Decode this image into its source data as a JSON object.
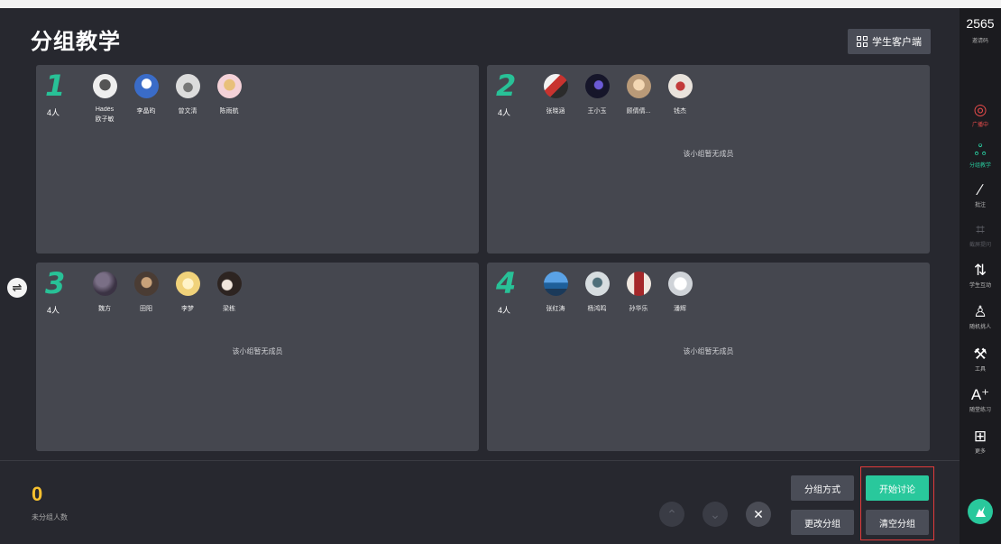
{
  "header": {
    "title": "分组教学",
    "client_button": "学生客户端"
  },
  "groups": [
    {
      "number": "1",
      "count": "4人",
      "members": [
        "Hadès",
        "李晶昀",
        "曾文清",
        "陈雨航"
      ],
      "extra_name": "欧子敏",
      "empty_text": ""
    },
    {
      "number": "2",
      "count": "4人",
      "members": [
        "张晓涵",
        "王小玉",
        "顾倩倩...",
        "钱杰"
      ],
      "empty_text": "该小组暂无成员"
    },
    {
      "number": "3",
      "count": "4人",
      "members": [
        "魏方",
        "田阳",
        "李梦",
        "梁栋"
      ],
      "empty_text": "该小组暂无成员"
    },
    {
      "number": "4",
      "count": "4人",
      "members": [
        "张红涛",
        "杨鸿鸣",
        "孙华乐",
        "潘辉"
      ],
      "empty_text": "该小组暂无成员"
    }
  ],
  "bottom": {
    "ungrouped_count": "0",
    "ungrouped_label": "未分组人数",
    "btn_group_method": "分组方式",
    "btn_change_group": "更改分组",
    "btn_start_discussion": "开始讨论",
    "btn_clear_group": "清空分组"
  },
  "sidebar": {
    "code": "2565",
    "code_label": "邀请码",
    "items": [
      {
        "label": "广播中",
        "icon": "broadcast-icon",
        "state": "red"
      },
      {
        "label": "分组教学",
        "icon": "group-icon",
        "state": "green"
      },
      {
        "label": "批注",
        "icon": "pen-icon",
        "state": "normal"
      },
      {
        "label": "截屏提问",
        "icon": "crop-icon",
        "state": "dim"
      },
      {
        "label": "学生互动",
        "icon": "interact-icon",
        "state": "normal"
      },
      {
        "label": "随机挑人",
        "icon": "person-icon",
        "state": "normal"
      },
      {
        "label": "工具",
        "icon": "wrench-icon",
        "state": "normal"
      },
      {
        "label": "随堂练习",
        "icon": "practice-icon",
        "state": "normal"
      },
      {
        "label": "更多",
        "icon": "grid-icon",
        "state": "normal"
      }
    ]
  },
  "colors": {
    "accent": "#29c89c",
    "warning": "#f7c12f",
    "alert": "#e84b4b"
  }
}
